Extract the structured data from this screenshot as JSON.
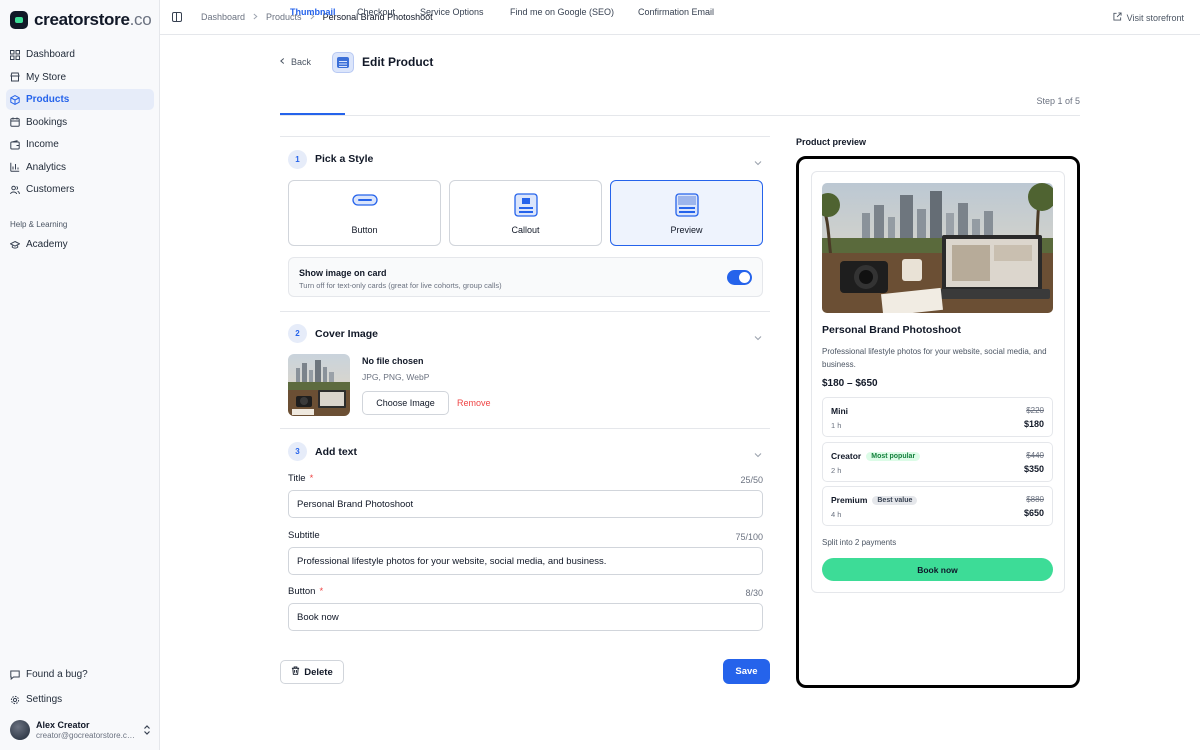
{
  "brand": {
    "name": "creatorstore",
    "tld": ".co"
  },
  "sidebar": {
    "items": [
      {
        "label": "Dashboard",
        "icon": "grid-icon"
      },
      {
        "label": "My Store",
        "icon": "store-icon"
      },
      {
        "label": "Products",
        "icon": "box-icon",
        "active": true
      },
      {
        "label": "Bookings",
        "icon": "calendar-icon"
      },
      {
        "label": "Income",
        "icon": "wallet-icon"
      },
      {
        "label": "Analytics",
        "icon": "bar-chart-icon"
      },
      {
        "label": "Customers",
        "icon": "users-icon"
      }
    ],
    "section_label": "Help & Learning",
    "learning_items": [
      {
        "label": "Academy",
        "icon": "graduation-cap-icon"
      }
    ],
    "bottom_items": [
      {
        "label": "Found a bug?",
        "icon": "message-icon"
      },
      {
        "label": "Settings",
        "icon": "gear-icon"
      }
    ],
    "user": {
      "name": "Alex Creator",
      "email": "creator@gocreatorstore.com"
    }
  },
  "topbar": {
    "breadcrumbs": [
      "Dashboard",
      "Products",
      "Personal Brand Photoshoot"
    ],
    "visit_label": "Visit storefront"
  },
  "header": {
    "back_label": "Back",
    "title": "Edit Product"
  },
  "tabs": [
    {
      "label": "Thumbnail",
      "active": true
    },
    {
      "label": "Checkout"
    },
    {
      "label": "Service Options"
    },
    {
      "label": "Find me on Google (SEO)"
    },
    {
      "label": "Confirmation Email"
    }
  ],
  "step_label": "Step 1 of 5",
  "section1": {
    "number": "1",
    "title": "Pick a Style",
    "styles": [
      {
        "label": "Button"
      },
      {
        "label": "Callout"
      },
      {
        "label": "Preview",
        "selected": true
      }
    ],
    "toggle": {
      "title": "Show image on card",
      "description": "Turn off for text-only cards (great for live cohorts, group calls)",
      "on": true
    }
  },
  "section2": {
    "number": "2",
    "title": "Cover Image",
    "file_status": "No file chosen",
    "formats": "JPG, PNG, WebP",
    "choose_label": "Choose Image",
    "remove_label": "Remove"
  },
  "section3": {
    "number": "3",
    "title": "Add text",
    "fields": {
      "title": {
        "label": "Title",
        "required": "*",
        "counter": "25/50",
        "value": "Personal Brand Photoshoot"
      },
      "subtitle": {
        "label": "Subtitle",
        "counter": "75/100",
        "value": "Professional lifestyle photos for your website, social media, and business."
      },
      "button": {
        "label": "Button",
        "required": "*",
        "counter": "8/30",
        "value": "Book now"
      }
    }
  },
  "footer": {
    "delete_label": "Delete",
    "save_label": "Save"
  },
  "preview": {
    "label": "Product preview",
    "title": "Personal Brand Photoshoot",
    "subtitle": "Professional lifestyle photos for your website, social media, and business.",
    "price_range": "$180 – $650",
    "options": [
      {
        "name": "Mini",
        "duration": "1 h",
        "old_price": "$220",
        "price": "$180",
        "badge": ""
      },
      {
        "name": "Creator",
        "duration": "2 h",
        "old_price": "$440",
        "price": "$350",
        "badge": "Most popular",
        "badge_style": "green"
      },
      {
        "name": "Premium",
        "duration": "4 h",
        "old_price": "$880",
        "price": "$650",
        "badge": "Best value",
        "badge_style": "gray"
      }
    ],
    "split_label": "Split into 2 payments",
    "button_label": "Book now"
  },
  "colors": {
    "accent": "#2563eb",
    "cta_green": "#3ddc97",
    "danger": "#ef4444"
  }
}
